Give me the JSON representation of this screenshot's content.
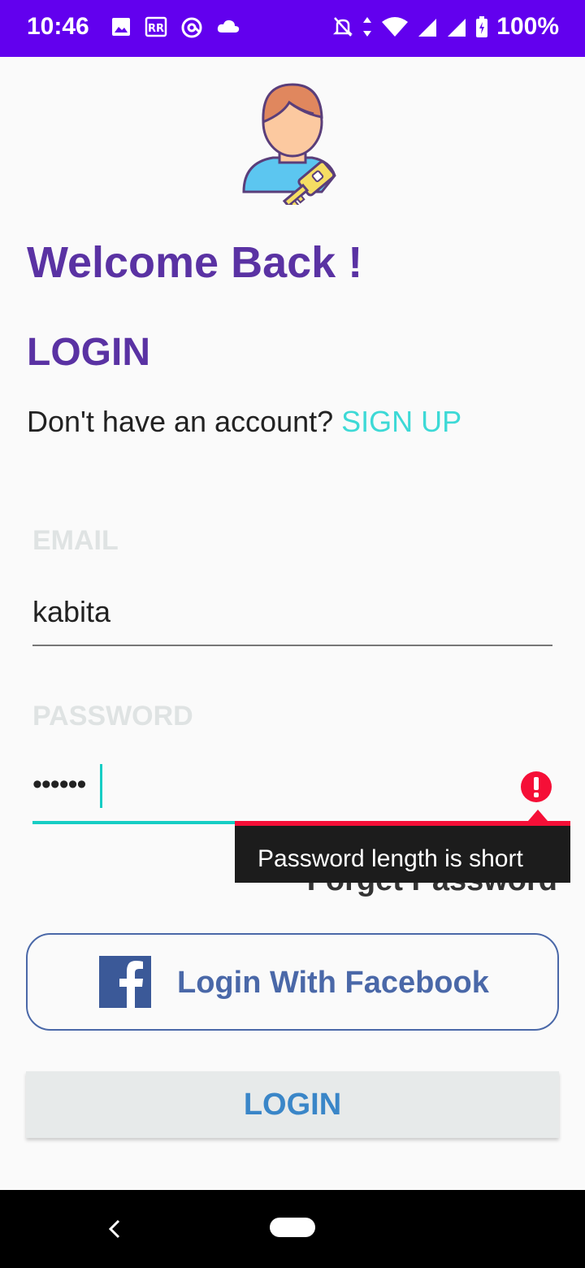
{
  "status_bar": {
    "time": "10:46",
    "battery": "100%",
    "left_icons": [
      "image-icon",
      "sim-card-icon",
      "at-sign-icon",
      "cloud-icon"
    ],
    "right_icons": [
      "alarm-off-icon",
      "data-arrows-icon",
      "wifi-icon",
      "signal-icon",
      "signal-icon",
      "battery-icon"
    ],
    "background": "#6200ee"
  },
  "header": {
    "welcome": "Welcome Back !",
    "title": "LOGIN",
    "signup_prompt": "Don't have an account?",
    "signup_link": "SIGN UP"
  },
  "form": {
    "email_label": "EMAIL",
    "email_value": "kabita",
    "password_label": "PASSWORD",
    "password_value": "••••••",
    "error_message": "Password length is short",
    "forget_password": "Forget Password"
  },
  "buttons": {
    "facebook": "Login With Facebook",
    "login": "LOGIN"
  },
  "colors": {
    "accent_purple": "#5a32a3",
    "link_cyan": "#3dd9d6",
    "facebook_blue": "#4a68a8",
    "error_red": "#f50f37",
    "login_text": "#3a86c8"
  }
}
